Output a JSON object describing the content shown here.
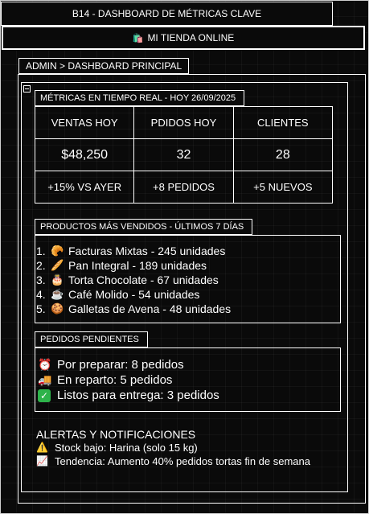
{
  "window": {
    "title": "B14 - DASHBOARD DE MÉTRICAS CLAVE"
  },
  "store": {
    "icon": "🛍️",
    "name": "MI TIENDA ONLINE"
  },
  "breadcrumb": "ADMIN > DASHBOARD PRINCIPAL",
  "metrics": {
    "section_label": "MÉTRICAS EN TIEMPO REAL - HOY 26/09/2025",
    "columns": [
      {
        "header": "VENTAS HOY",
        "value": "$48,250",
        "delta": "+15% VS AYER"
      },
      {
        "header": "PDIDOS HOY",
        "value": "32",
        "delta": "+8 PEDIDOS"
      },
      {
        "header": "CLIENTES",
        "value": "28",
        "delta": "+5 NUEVOS"
      }
    ]
  },
  "products": {
    "section_label": "PRODUCTOS MÁS VENDIDOS - ÚLTIMOS 7 DÍAS",
    "items": [
      {
        "num": "1.",
        "icon": "🥐",
        "icon_name": "croissant-icon",
        "text": "Facturas Mixtas - 245 unidades"
      },
      {
        "num": "2.",
        "icon": "🥖",
        "icon_name": "bread-icon",
        "text": "Pan Integral - 189 unidades"
      },
      {
        "num": "3.",
        "icon": "🎂",
        "icon_name": "cake-icon",
        "text": "Torta Chocolate - 67 unidades"
      },
      {
        "num": "4.",
        "icon": "☕",
        "icon_name": "coffee-icon",
        "text": "Café Molido - 54 unidades"
      },
      {
        "num": "5.",
        "icon": "🍪",
        "icon_name": "cookie-icon",
        "text": "Galletas de Avena - 48 unidades"
      }
    ]
  },
  "pending": {
    "section_label": "PEDIDOS PENDIENTES",
    "items": [
      {
        "icon": "⏰",
        "icon_name": "alarm-clock-icon",
        "text": "Por preparar: 8 pedidos"
      },
      {
        "icon": "🚚",
        "icon_name": "delivery-truck-icon",
        "text": "En reparto: 5 pedidos"
      },
      {
        "icon": "✓",
        "icon_name": "check-icon",
        "text": "Listos para entrega: 3 pedidos"
      }
    ]
  },
  "alerts": {
    "title": "ALERTAS Y NOTIFICACIONES",
    "items": [
      {
        "icon": "⚠️",
        "icon_name": "warning-icon",
        "text": "Stock bajo: Harina (solo 15 kg)"
      },
      {
        "icon": "📈",
        "icon_name": "trend-chart-icon",
        "text": "Tendencia: Aumento 40% pedidos tortas fin de semana"
      }
    ]
  },
  "colors": {
    "background": "#0a0a0a",
    "foreground": "#ffffff",
    "check_green": "#2db34a"
  }
}
